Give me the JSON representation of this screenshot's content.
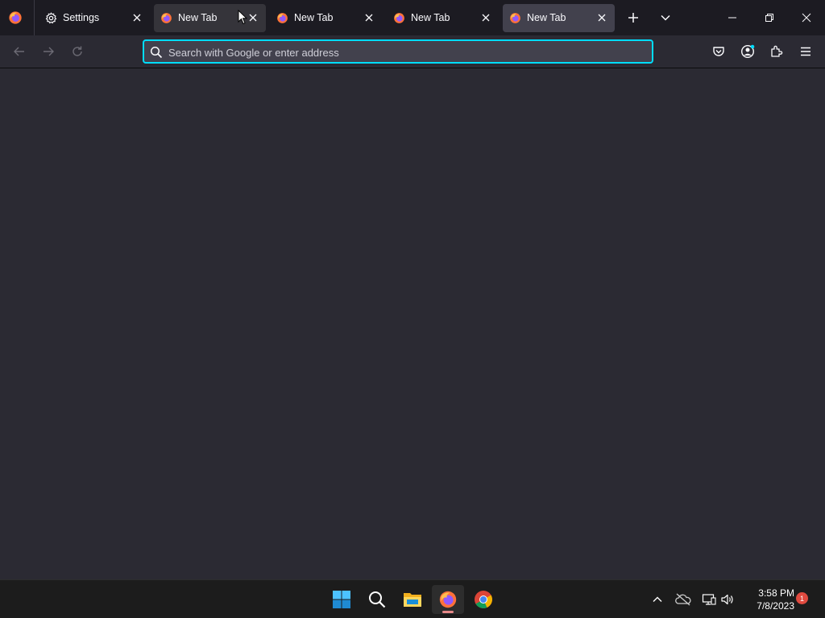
{
  "browser": {
    "tabs": [
      {
        "label": "Settings",
        "icon": "gear-icon",
        "state": "normal"
      },
      {
        "label": "New Tab",
        "icon": "firefox-icon",
        "state": "hover"
      },
      {
        "label": "New Tab",
        "icon": "firefox-icon",
        "state": "normal"
      },
      {
        "label": "New Tab",
        "icon": "firefox-icon",
        "state": "normal"
      },
      {
        "label": "New Tab",
        "icon": "firefox-icon",
        "state": "active"
      }
    ],
    "urlbar": {
      "placeholder": "Search with Google or enter address",
      "value": ""
    }
  },
  "taskbar": {
    "apps": [
      "start-icon",
      "search-icon",
      "file-explorer-icon",
      "firefox-icon",
      "chrome-icon"
    ],
    "clock": {
      "time": "3:58 PM",
      "date": "7/8/2023"
    },
    "notification_count": "1"
  },
  "colors": {
    "tabbar_bg": "#1c1b22",
    "toolbar_bg": "#2b2a33",
    "active_tab": "#42414d",
    "focus_ring": "#00ddff",
    "taskbar_bg": "#1c1c1c"
  }
}
